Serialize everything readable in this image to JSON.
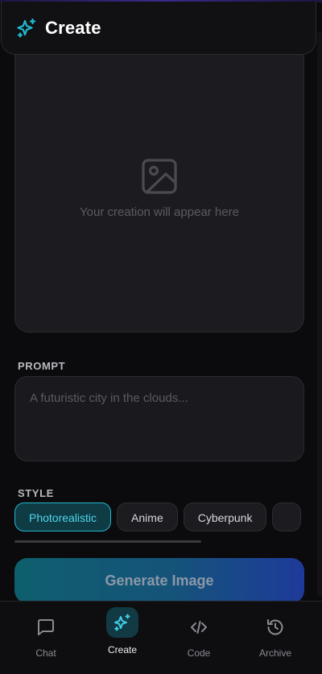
{
  "header": {
    "title": "Create",
    "icon": "sparkles-icon"
  },
  "preview": {
    "icon": "image-icon",
    "placeholder": "Your creation will appear here"
  },
  "prompt": {
    "label": "PROMPT",
    "placeholder": "A futuristic city in the clouds..."
  },
  "style": {
    "label": "STYLE",
    "options": [
      "Photorealistic",
      "Anime",
      "Cyberpunk",
      ""
    ],
    "selected": "Photorealistic"
  },
  "actions": {
    "generate_label": "Generate Image"
  },
  "nav": {
    "items": [
      {
        "label": "Chat",
        "icon": "chat-icon"
      },
      {
        "label": "Create",
        "icon": "sparkles-icon"
      },
      {
        "label": "Code",
        "icon": "code-icon"
      },
      {
        "label": "Archive",
        "icon": "history-icon"
      }
    ],
    "active": "Create"
  },
  "colors": {
    "accent": "#22b8cf",
    "background": "#0b0b0d",
    "surface": "#1c1c20",
    "generate_gradient_start": "#0e5f6d",
    "generate_gradient_end": "#1e3a9a"
  }
}
